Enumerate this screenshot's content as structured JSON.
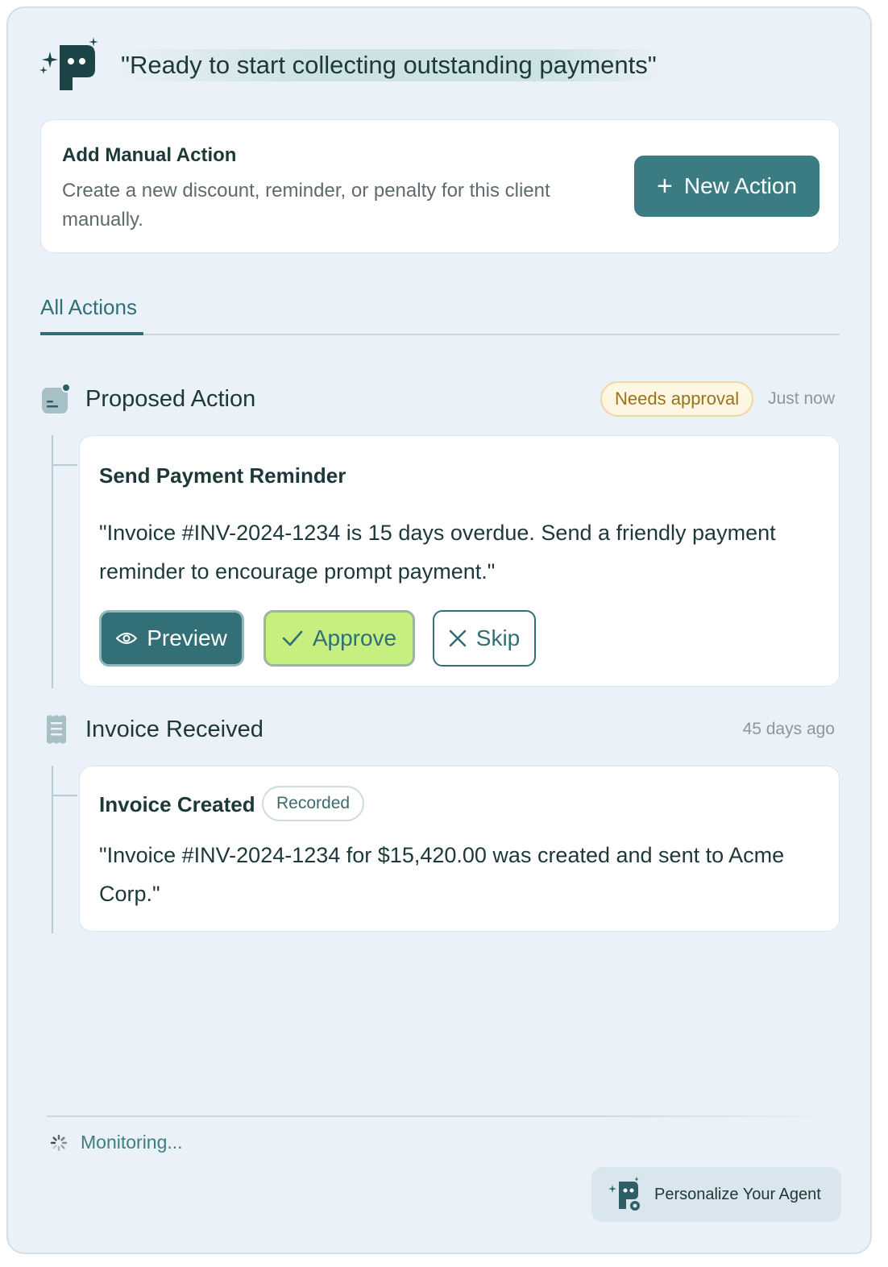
{
  "header": {
    "title": "\"Ready to start collecting outstanding payments\"",
    "logo_icon": "agent-logo-icon"
  },
  "manual_action": {
    "title": "Add Manual Action",
    "description": "Create a new discount, reminder, or penalty for this client manually.",
    "button_label": "New Action"
  },
  "tabs": [
    {
      "label": "All Actions",
      "active": true
    }
  ],
  "timeline": {
    "proposed": {
      "section_title": "Proposed Action",
      "badge": "Needs approval",
      "time": "Just now",
      "icon": "proposed-action-icon",
      "card": {
        "title": "Send Payment Reminder",
        "text": "\"Invoice #INV-2024-1234 is 15 days overdue. Send a friendly payment reminder to encourage prompt payment.\"",
        "buttons": {
          "preview": "Preview",
          "approve": "Approve",
          "skip": "Skip"
        }
      }
    },
    "invoice": {
      "section_title": "Invoice Received",
      "time": "45 days ago",
      "icon": "receipt-icon",
      "card": {
        "title": "Invoice Created",
        "badge": "Recorded",
        "text": "\"Invoice #INV-2024-1234 for $15,420.00 was created and sent to Acme Corp.\""
      }
    }
  },
  "footer": {
    "status": "Monitoring...",
    "personalize_label": "Personalize Your Agent"
  },
  "colors": {
    "panel_bg": "#eaf1f8",
    "accent": "#3b7c82",
    "approve_bg": "#c7ef80",
    "badge_warning": "#9a7414"
  }
}
